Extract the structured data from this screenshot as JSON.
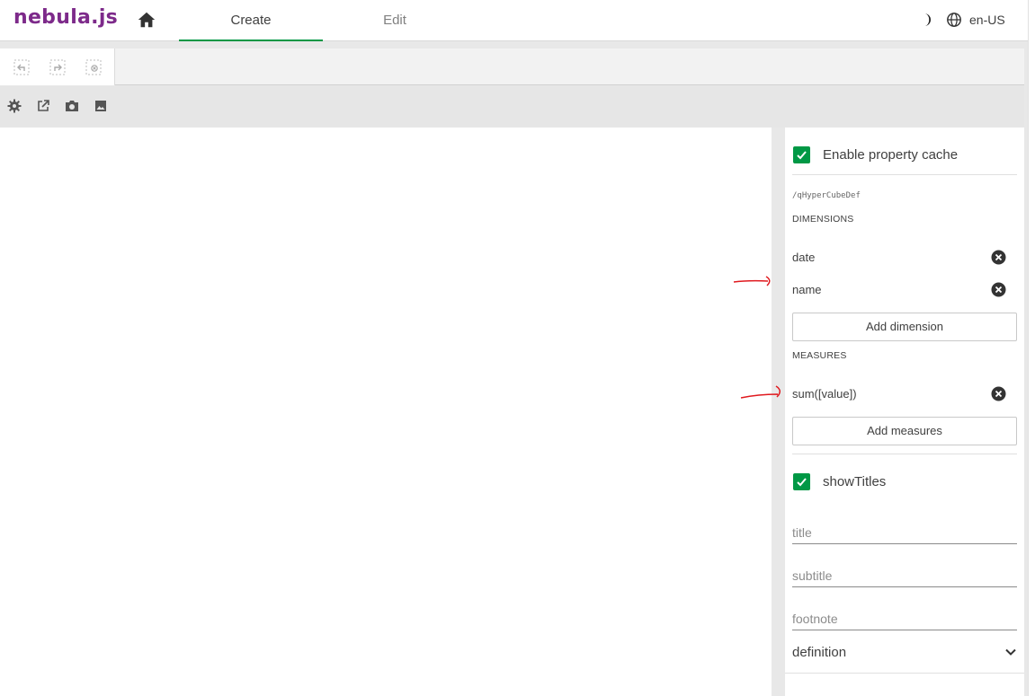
{
  "app": {
    "logo": "nebula.js",
    "tabs": [
      {
        "label": "Create",
        "active": true
      },
      {
        "label": "Edit",
        "active": false
      }
    ],
    "language": "en-US",
    "accent_color": "#009845",
    "logo_color": "#7d2a8a"
  },
  "icons": {
    "home": "home-icon",
    "theme": "moon-icon",
    "language": "globe-icon",
    "undo": "undo-icon",
    "redo": "redo-icon",
    "clear": "clear-selections-icon",
    "settings": "gear-icon",
    "open_external": "open-external-icon",
    "snapshot": "camera-icon",
    "image": "image-icon",
    "remove": "remove-circle-icon",
    "chevron": "chevron-down-icon"
  },
  "panel": {
    "property_cache": {
      "label": "Enable property cache",
      "checked": true
    },
    "path": "/qHyperCubeDef",
    "dimensions": {
      "heading": "DIMENSIONS",
      "items": [
        "date",
        "name"
      ],
      "add_label": "Add dimension"
    },
    "measures": {
      "heading": "MEASURES",
      "items": [
        "sum([value])"
      ],
      "add_label": "Add measures"
    },
    "show_titles": {
      "label": "showTitles",
      "checked": true
    },
    "fields": {
      "title_placeholder": "title",
      "subtitle_placeholder": "subtitle",
      "footnote_placeholder": "footnote"
    },
    "definition_label": "definition"
  }
}
